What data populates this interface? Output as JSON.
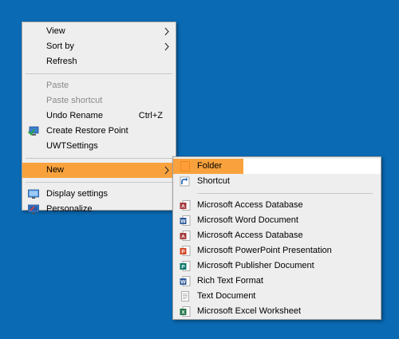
{
  "main_menu": {
    "view": "View",
    "sort_by": "Sort by",
    "refresh": "Refresh",
    "paste": "Paste",
    "paste_shortcut": "Paste shortcut",
    "undo_rename": "Undo Rename",
    "undo_shortcut": "Ctrl+Z",
    "create_restore_point": "Create Restore Point",
    "uwt_settings": "UWTSettings",
    "new": "New",
    "display_settings": "Display settings",
    "personalize": "Personalize"
  },
  "sub_menu": {
    "folder": "Folder",
    "shortcut": "Shortcut",
    "items": [
      "Microsoft Access Database",
      "Microsoft Word Document",
      "Microsoft Access Database",
      "Microsoft PowerPoint Presentation",
      "Microsoft Publisher Document",
      "Rich Text Format",
      "Text Document",
      "Microsoft Excel Worksheet"
    ]
  },
  "colors": {
    "desktop": "#0a6ab4",
    "menu_bg": "#eeeeee",
    "highlight": "#f9a23d"
  }
}
